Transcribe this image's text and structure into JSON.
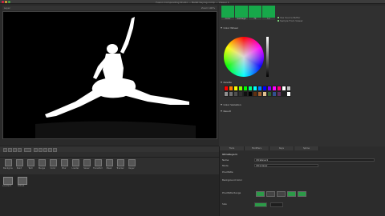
{
  "window": {
    "title": "Fusion Compositing Studio — Ballet Keying.comp — Viewer 1"
  },
  "viewer": {
    "header_left": "Layer",
    "header_right": "Zoom 100%"
  },
  "swatches": {
    "labels": [
      "Color",
      "Garbage",
      "Hi",
      "Lo"
    ],
    "color": "#17a84a",
    "options": [
      "Use Source Buffer",
      "Sample From Viewer"
    ]
  },
  "sections": {
    "color_wheel": "Color Wheel",
    "palette": "Palette",
    "color_variation": "Color Variation",
    "result": "Result"
  },
  "palette_colors": [
    "#ff0000",
    "#ff8000",
    "#ffff00",
    "#80ff00",
    "#00ff00",
    "#00ff80",
    "#00ffff",
    "#0080ff",
    "#0000ff",
    "#8000ff",
    "#ff00ff",
    "#ff0080",
    "#ffffff",
    "#c0c0c0",
    "#909090",
    "#707070",
    "#505050",
    "#303030",
    "#101010",
    "#000000",
    "#603010",
    "#a06030",
    "#e0c090",
    "#306030",
    "#305090",
    "#603060",
    "#202020",
    "#ffffff"
  ],
  "tools": [
    "Background",
    "Paint",
    "Text",
    "Merge",
    "Color",
    "Blur",
    "Loader",
    "Saver",
    "Transform",
    "Mask",
    "Tracker",
    "Keyer"
  ],
  "nodes": [
    {
      "label": "Loader1"
    },
    {
      "label": "Ultra1"
    }
  ],
  "inspector": {
    "tabs": [
      "Tools",
      "Modifiers",
      "Keys",
      "Spline"
    ],
    "tool_title": "UltraKeyer1",
    "rows": [
      {
        "label": "Name",
        "value": "UltraKeyer1"
      },
      {
        "label": "Mode",
        "value": "Ultra   Keyer"
      },
      {
        "label": "Pre-Matte",
        "value": ""
      },
      {
        "label": "Background Color",
        "value": ""
      },
      {
        "label": "Pre-Matte Range",
        "value": ""
      },
      {
        "label": "Size",
        "value": ""
      }
    ]
  }
}
